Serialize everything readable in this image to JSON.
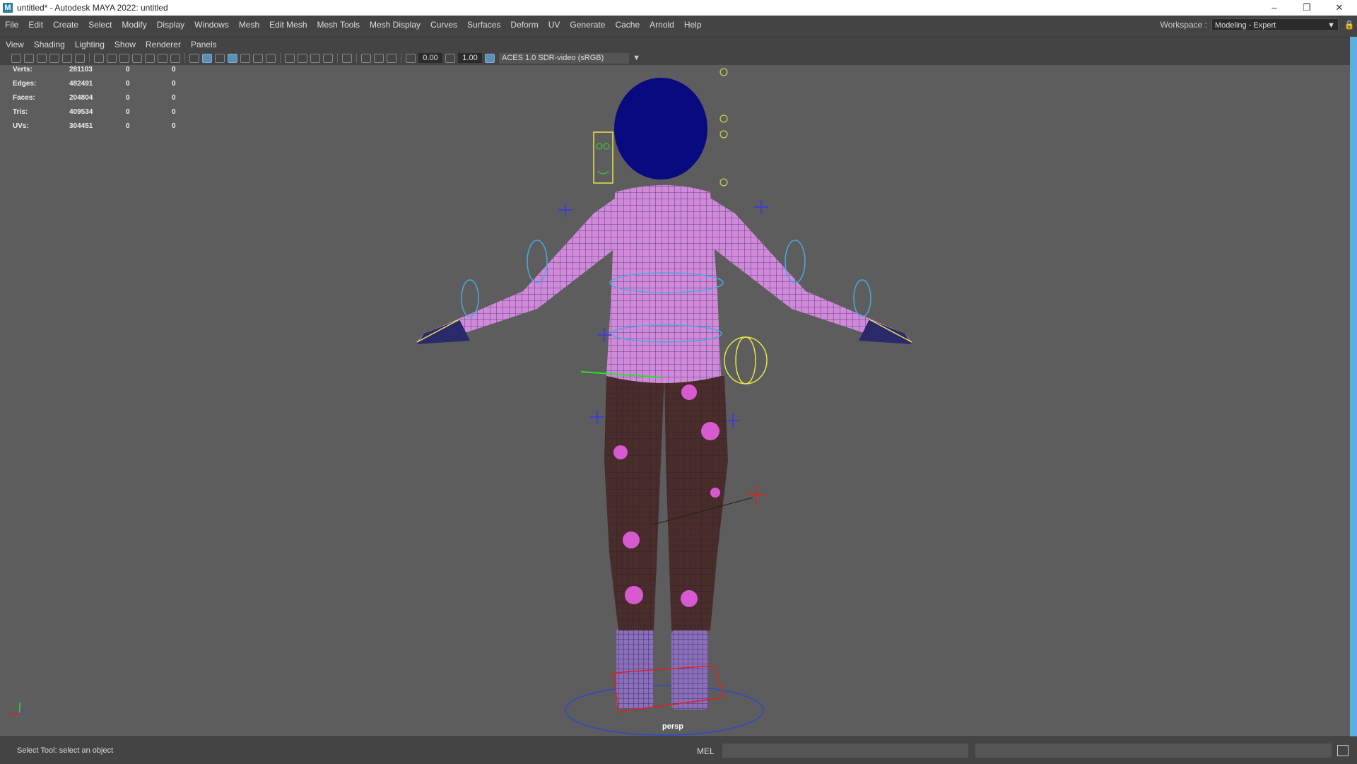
{
  "window": {
    "title": "untitled* - Autodesk MAYA 2022: untitled",
    "app_icon": "M",
    "controls": {
      "minimize": "–",
      "restore": "❐",
      "close": "✕"
    }
  },
  "menubar": {
    "items": [
      "File",
      "Edit",
      "Create",
      "Select",
      "Modify",
      "Display",
      "Windows",
      "Mesh",
      "Edit Mesh",
      "Mesh Tools",
      "Mesh Display",
      "Curves",
      "Surfaces",
      "Deform",
      "UV",
      "Generate",
      "Cache",
      "Arnold",
      "Help"
    ]
  },
  "workspace": {
    "label": "Workspace :",
    "value": "Modeling - Expert",
    "arrow": "▼",
    "lock": "🔒"
  },
  "panel_menu": {
    "items": [
      "View",
      "Shading",
      "Lighting",
      "Show",
      "Renderer",
      "Panels"
    ]
  },
  "toolbar": {
    "exposure": "0.00",
    "gamma": "1.00",
    "color_space": "ACES 1.0 SDR-video (sRGB)",
    "arrow": "▼"
  },
  "hud": {
    "rows": [
      {
        "label": "Verts:",
        "value": "281103",
        "sel": "0",
        "uv": "0"
      },
      {
        "label": "Edges:",
        "value": "482491",
        "sel": "0",
        "uv": "0"
      },
      {
        "label": "Faces:",
        "value": "204804",
        "sel": "0",
        "uv": "0"
      },
      {
        "label": "Tris:",
        "value": "409534",
        "sel": "0",
        "uv": "0"
      },
      {
        "label": "UVs:",
        "value": "304451",
        "sel": "0",
        "uv": "0"
      }
    ]
  },
  "viewport": {
    "camera": "persp",
    "axis_labels": {
      "x": "x",
      "y": "y",
      "z": "z"
    }
  },
  "status": {
    "help_line": "Select Tool: select an object",
    "mel_label": "MEL"
  },
  "colors": {
    "mesh": "#d08ad8",
    "wire": "#3a2a7a",
    "pants": "#4a2e26",
    "hair": "#0a0a80",
    "controls": "#4aa8e0",
    "selection": "#e6e64a"
  }
}
